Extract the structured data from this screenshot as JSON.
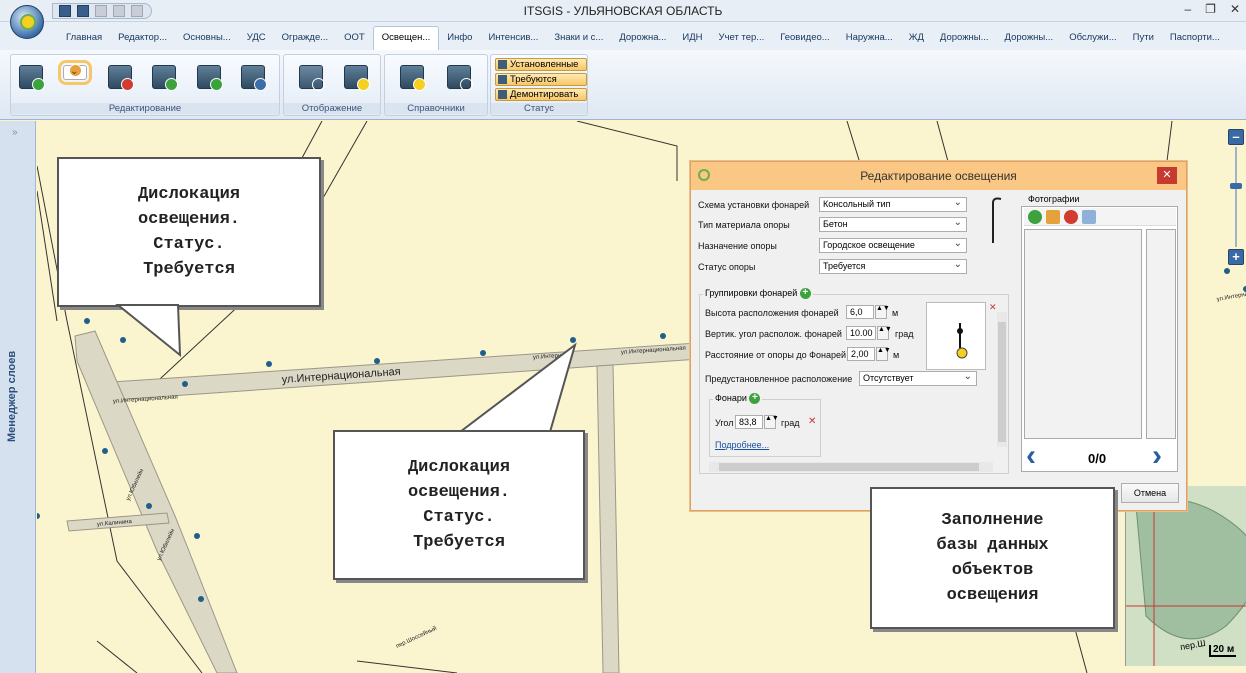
{
  "window": {
    "title": "ITSGIS - УЛЬЯНОВСКАЯ ОБЛАСТЬ",
    "minimize": "–",
    "maximize": "❐",
    "close": "✕"
  },
  "tabs": [
    "Главная",
    "Редактор...",
    "Основны...",
    "УДС",
    "Огражде...",
    "ООТ",
    "Освещен...",
    "Инфо",
    "Интенсив...",
    "Знаки и с...",
    "Дорожна...",
    "ИДН",
    "Учет тер...",
    "Геовидео...",
    "Наружна...",
    "ЖД",
    "Дорожны...",
    "Дорожны...",
    "Обслужи...",
    "Пути",
    "Паспорти..."
  ],
  "active_tab": "Освещен...",
  "ribbon": {
    "groups": {
      "edit": "Редактирование",
      "display": "Отображение",
      "refs": "Справочники",
      "status": "Статус"
    },
    "status_buttons": [
      "Установленные",
      "Требуются",
      "Демонтировать"
    ]
  },
  "layer_manager": "Менеджер слоев",
  "map": {
    "streets": {
      "main": "ул.Интернациональная",
      "main_small_left": "ул.Интернациональная",
      "main_small_right": "ул.Интернациональная",
      "main_small_mid": "ул.Интерн...",
      "kalinina": "ул.Калинина",
      "vertical1": "ул.Юбилейн",
      "vertical2": "ул.Юбилейн",
      "bottom": "пер.Шоссейный",
      "right": "ул.Интернац"
    },
    "scale": "20 м",
    "bottom_right_label": "пер.Ш"
  },
  "callouts": {
    "top_left": [
      "Дислокация",
      "освещения.",
      "Статус.",
      "Требуется"
    ],
    "center": [
      "Дислокация",
      "освещения.",
      "Статус.",
      "Требуется"
    ],
    "right": [
      "Заполнение",
      "базы данных",
      "объектов",
      "освещения"
    ]
  },
  "dialog": {
    "title": "Редактирование освещения",
    "fields": [
      {
        "label": "Схема установки фонарей",
        "value": "Консольный тип"
      },
      {
        "label": "Тип материала опоры",
        "value": "Бетон"
      },
      {
        "label": "Назначение опоры",
        "value": "Городское освещение"
      },
      {
        "label": "Статус опоры",
        "value": "Требуется"
      }
    ],
    "groups_legend": "Группировки фонарей",
    "height": {
      "label": "Высота расположения фонарей",
      "value": "6,0",
      "unit": "м"
    },
    "angle": {
      "label": "Вертик. угол располож. фонарей",
      "value": "10.00",
      "unit": "град"
    },
    "distance": {
      "label": "Расстояние от опоры до Фонарей",
      "value": "2,00",
      "unit": "м"
    },
    "preset": {
      "label": "Предустановленное расположение",
      "value": "Отсутствует"
    },
    "lamps_legend": "Фонари",
    "lamp_angle": {
      "label": "Угол",
      "value": "83,8",
      "unit": "град"
    },
    "more_link": "Подробнее...",
    "photos_label": "Фотографии",
    "photo_counter": "0/0",
    "cancel": "Отмена"
  }
}
